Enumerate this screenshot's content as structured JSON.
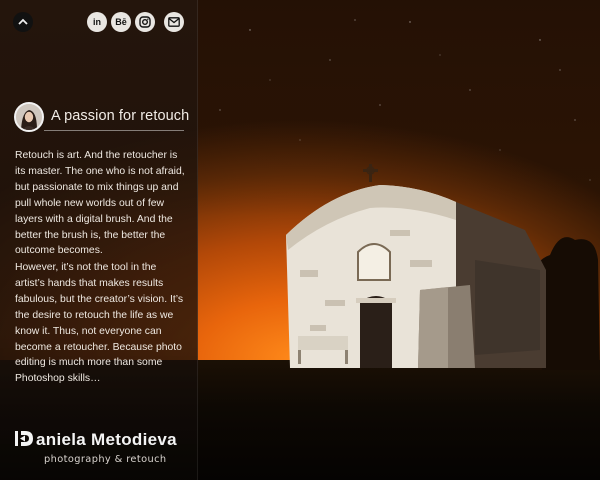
{
  "header": {
    "collapse_icon": "chevron-up-icon",
    "social": [
      {
        "name": "linkedin",
        "label": "in",
        "icon": "linkedin-icon"
      },
      {
        "name": "behance",
        "label": "Bē",
        "icon": "behance-icon"
      },
      {
        "name": "instagram",
        "icon": "instagram-icon"
      },
      {
        "name": "email",
        "icon": "envelope-icon"
      }
    ]
  },
  "about": {
    "title": "A passion for retouch",
    "paragraph1": "Retouch is art. And the retoucher is its master. The one who is not afraid, but passionate to mix things up and pull whole new worlds out of few layers with a digital brush. And the better the brush is, the better the outcome becomes.",
    "paragraph2": "However, it’s not the tool in the artist’s hands that makes results fabulous, but the creator’s vision. It’s the desire to retouch the life as we know it. Thus, not everyone can become a retoucher. Because photo editing is much more than some Photoshop skills…"
  },
  "brand": {
    "name": "aniela Metodieva",
    "tagline": "photography & retouch"
  },
  "colors": {
    "panel_text": "#efe9e2",
    "sky_glow": "#ff8a1a",
    "social_bg": "#e9e6e2"
  }
}
